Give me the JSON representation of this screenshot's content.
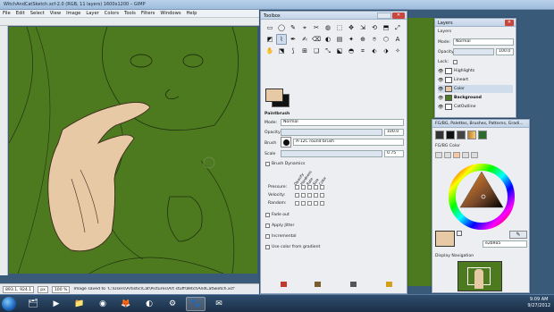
{
  "window": {
    "title": "WitchAndCatSketch.xcf-2.0 (RGB, 11 layers) 1600x1200 – GIMP"
  },
  "menu": [
    "File",
    "Edit",
    "Select",
    "View",
    "Image",
    "Layer",
    "Colors",
    "Tools",
    "Filters",
    "Windows",
    "Help"
  ],
  "status": {
    "coords": "893.1, 924.1",
    "unit": "px",
    "zoom": "100 %",
    "message": "Image saved to 'C:\\Users\\Artistic\\Cat\\Pictures\\Art stuff\\WitchAndCatSketch.xcf'"
  },
  "toolbox": {
    "title": "Toolbox",
    "tools": [
      "▭",
      "◯",
      "✎",
      "⌖",
      "✂",
      "◍",
      "⬚",
      "✥",
      "⇲",
      "⟲",
      "⬒",
      "⤢",
      "◩",
      "⌇",
      "✒",
      "✍",
      "⌫",
      "◐",
      "▤",
      "✦",
      "⊕",
      "⌾",
      "⬡",
      "A",
      "✋",
      "⬔",
      "⟆",
      "⊞",
      "❏",
      "⤡",
      "⬕",
      "◓",
      "⌗",
      "⬖",
      "⬗",
      "✧"
    ],
    "active_index": 13,
    "tool_options_title": "Paintbrush",
    "mode_label": "Mode:",
    "mode_value": "Normal",
    "opacity_label": "Opacity",
    "opacity_value": "100.0",
    "brush_label": "Brush",
    "brush_value": "A-12C round brush",
    "scale_label": "Scale",
    "scale_value": "0.75",
    "brush_dynamics_label": "Brush Dynamics",
    "dyn_cols": [
      "Opacity",
      "Hardness",
      "Rate",
      "Size",
      "Color"
    ],
    "dyn_rows": [
      "Pressure:",
      "Velocity:",
      "Random:"
    ],
    "fade_out": "Fade out",
    "apply_jitter": "Apply Jitter",
    "incremental": "Incremental",
    "use_color_gradient": "Use color from gradient"
  },
  "layers": {
    "title": "Layers",
    "panel_label": "Layers",
    "mode_label": "Mode:",
    "mode_value": "Normal",
    "opacity_label": "Opacity",
    "opacity_value": "100.0",
    "lock_label": "Lock:",
    "rows": [
      "Highlights",
      "Lineart",
      "Color",
      "Background",
      "CatOutline"
    ]
  },
  "fgbg": {
    "title": "FG/BG, Palettes, Brushes, Patterns, Gradi...",
    "panel_label": "FG/BG Color",
    "hex": "e2b9a5",
    "nav_label": "Display Navigation"
  },
  "taskbar": {
    "time": "9:09 AM",
    "date": "9/27/2012"
  },
  "colors": {
    "fg": "#e8c9a6",
    "canvas": "#4d7a1f"
  }
}
